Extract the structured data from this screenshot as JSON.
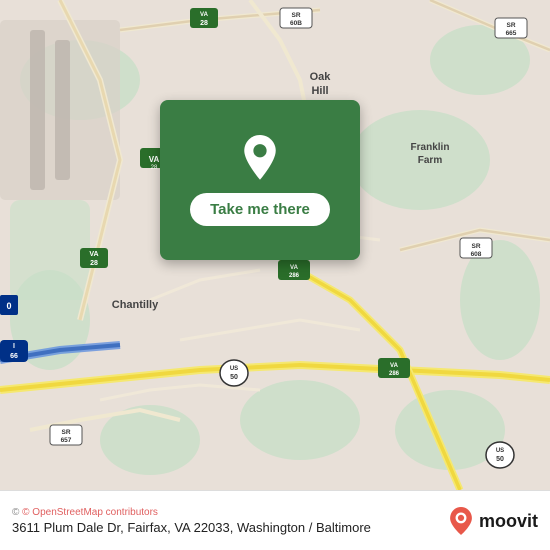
{
  "map": {
    "alt": "Map of Chantilly, VA area near Fairfax"
  },
  "action_card": {
    "button_label": "Take me there"
  },
  "bottom_bar": {
    "copyright": "© OpenStreetMap contributors",
    "address": "3611 Plum Dale Dr, Fairfax, VA 22033, Washington /",
    "city_line": "Baltimore",
    "moovit_brand": "moovit"
  }
}
